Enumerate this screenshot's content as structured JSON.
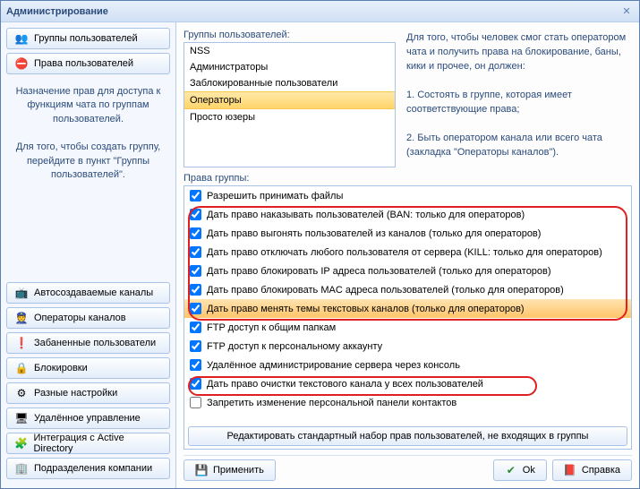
{
  "window": {
    "title": "Администрирование"
  },
  "sidebar": {
    "top": [
      {
        "icon": "👥",
        "label": "Группы пользователей"
      },
      {
        "icon": "⛔",
        "label": "Права пользователей"
      }
    ],
    "help1": "Назначение прав для доступа к функциям чата по группам пользователей.",
    "help2": "Для того, чтобы создать группу, перейдите в пункт \"Группы пользователей\".",
    "bottom": [
      {
        "icon": "📺",
        "label": "Автосоздаваемые каналы"
      },
      {
        "icon": "👮",
        "label": "Операторы каналов"
      },
      {
        "icon": "❗",
        "label": "Забаненные пользователи"
      },
      {
        "icon": "🔒",
        "label": "Блокировки"
      },
      {
        "icon": "⚙",
        "label": "Разные настройки"
      },
      {
        "icon": "🖥",
        "label": "Удалённое управление"
      },
      {
        "icon": "🧩",
        "label": "Интеграция с Active Directory"
      },
      {
        "icon": "🏢",
        "label": "Подразделения компании"
      }
    ]
  },
  "groups": {
    "label": "Группы пользователей:",
    "items": [
      "NSS",
      "Администраторы",
      "Заблокированные пользователи",
      "Операторы",
      "Просто юзеры"
    ],
    "selectedIndex": 3
  },
  "info": {
    "p1": "Для того, чтобы человек смог стать оператором чата и получить права на блокирование, баны, кики и прочее, он должен:",
    "p2": "1. Состоять в группе, которая имеет соответствующие права;",
    "p3": "2. Быть оператором канала или всего чата (закладка \"Операторы каналов\")."
  },
  "rights": {
    "label": "Права группы:",
    "items": [
      {
        "checked": true,
        "text": "Разрешить принимать файлы"
      },
      {
        "checked": true,
        "text": "Дать право наказывать пользователей (BAN: только для операторов)"
      },
      {
        "checked": true,
        "text": "Дать право выгонять пользователей из каналов (только для операторов)"
      },
      {
        "checked": true,
        "text": "Дать право отключать любого пользователя от сервера (KILL: только для операторов)"
      },
      {
        "checked": true,
        "text": "Дать право блокировать IP адреса пользователей (только для операторов)"
      },
      {
        "checked": true,
        "text": "Дать право блокировать MAC адреса пользователей (только для операторов)"
      },
      {
        "checked": true,
        "text": "Дать право менять темы текстовых каналов (только для операторов)",
        "hl": true
      },
      {
        "checked": true,
        "text": "FTP доступ к общим папкам"
      },
      {
        "checked": true,
        "text": "FTP доступ к персональному аккаунту"
      },
      {
        "checked": true,
        "text": "Удалённое администрирование сервера через консоль"
      },
      {
        "checked": true,
        "text": "Дать право очистки текстового канала у всех пользователей"
      },
      {
        "checked": false,
        "text": "Запретить изменение персональной панели контактов"
      }
    ],
    "defaultBtn": "Редактировать стандартный набор прав пользователей, не входящих в группы"
  },
  "buttons": {
    "apply": "Применить",
    "ok": "Ok",
    "help": "Справка"
  }
}
